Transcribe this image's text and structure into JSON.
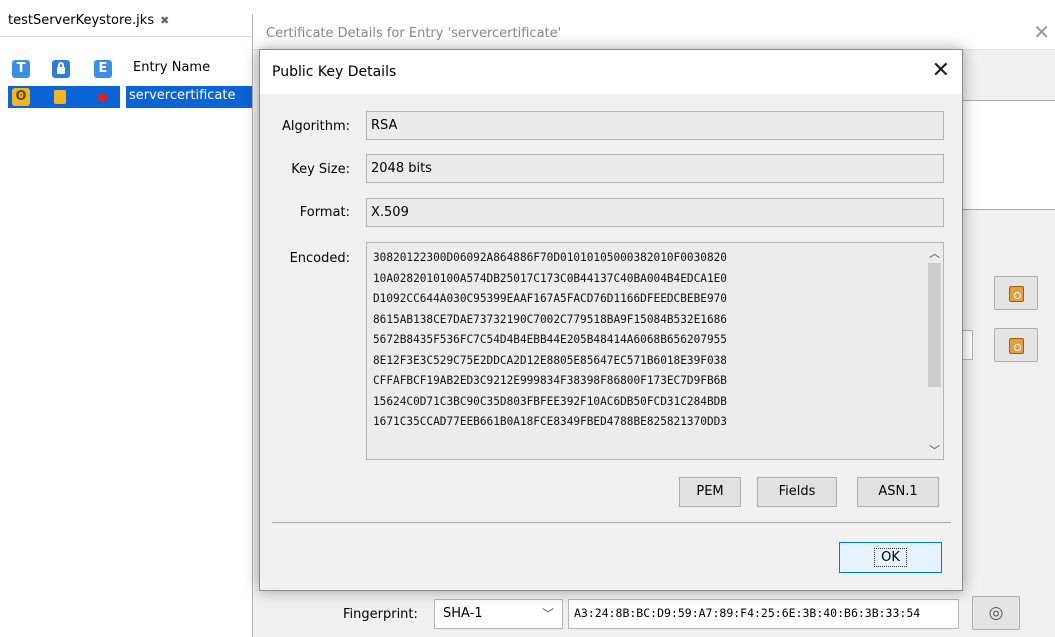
{
  "keystore": {
    "file_tab": "testServerKeystore.jks",
    "file_tab_close": "✖",
    "columns": {
      "type": "T",
      "lock": "🔒",
      "expiry": "E",
      "entry_name": "Entry Name"
    },
    "rows": [
      {
        "entry_name": "servercertificate"
      }
    ]
  },
  "cert_dialog": {
    "title": "Certificate Details for Entry 'servercertificate'",
    "close": "✕",
    "fingerprint_label": "Fingerprint:",
    "fingerprint_algorithm": "SHA-1",
    "fingerprint_value": "A3:24:8B:BC:D9:59:A7:89:F4:25:6E:3B:40:B6:3B:33:54"
  },
  "pk_dialog": {
    "title": "Public Key Details",
    "close": "✕",
    "algorithm_label": "Algorithm:",
    "algorithm_value": "RSA",
    "key_size_label": "Key Size:",
    "key_size_value": "2048 bits",
    "format_label": "Format:",
    "format_value": "X.509",
    "encoded_label": "Encoded:",
    "encoded_value": "30820122300D06092A864886F70D01010105000382010F0030820\n10A0282010100A574DB25017C173C0B44137C40BA004B4EDCA1E0\nD1092CC644A030C95399EAAF167A5FACD76D1166DFEEDCBEBE970\n8615AB138CE7DAE73732190C7002C779518BA9F15084B532E1686\n5672B8435F536FC7C54D4B4EBB44E205B48414A6068B656207955\n8E12F3E3C529C75E2DDCA2D12E8805E85647EC571B6018E39F038\nCFFAFBCF19AB2ED3C9212E999834F38398F86800F173EC7D9FB6B\n15624C0D71C3BC90C35D803FBFEE392F10AC6DB50FCD31C284BDB\n1671C35CCAD77EEB661B0A18FCE8349FBED4788BE825821370DD3",
    "buttons": {
      "pem": "PEM",
      "fields": "Fields",
      "asn1": "ASN.1",
      "ok": "OK"
    }
  },
  "colors": {
    "selection": "#0a64d6",
    "ok_border": "#0078d7"
  }
}
